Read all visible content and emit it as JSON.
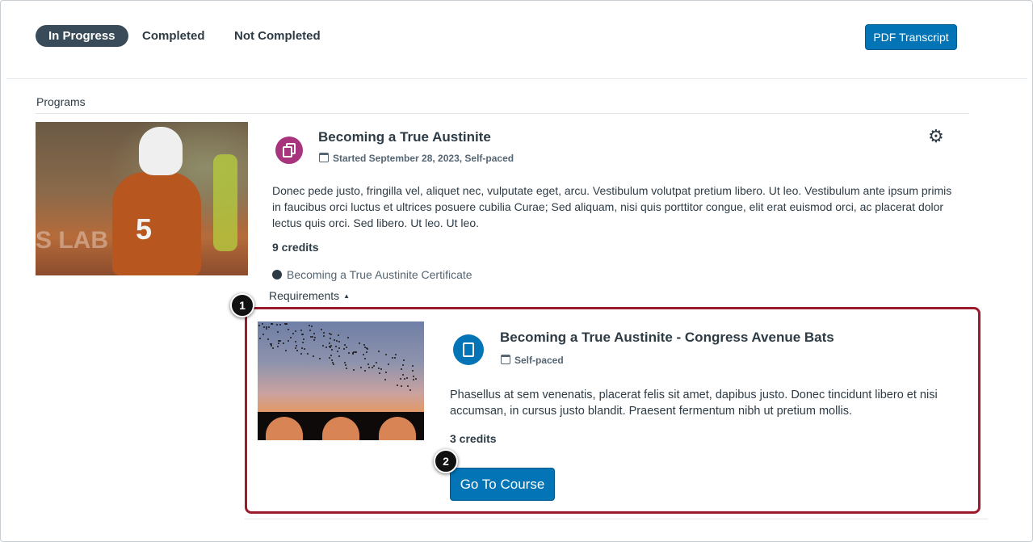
{
  "tabs": [
    {
      "label": "In Progress",
      "active": true
    },
    {
      "label": "Completed",
      "active": false
    },
    {
      "label": "Not Completed",
      "active": false
    }
  ],
  "header": {
    "pdf_button": "PDF Transcript"
  },
  "section_label": "Programs",
  "program": {
    "title": "Becoming a True Austinite",
    "meta": "Started September 28, 2023, Self-paced",
    "description": "Donec pede justo, fringilla vel, aliquet nec, vulputate eget, arcu. Vestibulum volutpat pretium libero. Ut leo. Vestibulum ante ipsum primis in faucibus orci luctus et ultrices posuere cubilia Curae; Sed aliquam, nisi quis porttitor congue, elit erat euismod orci, ac placerat dolor lectus quis orci. Sed libero. Ut leo. Ut leo.",
    "credits": "9 credits",
    "certificate": "Becoming a True Austinite Certificate",
    "requirements_label": "Requirements"
  },
  "requirement": {
    "title": "Becoming a True Austinite - Congress Avenue Bats",
    "meta": "Self-paced",
    "description": "Phasellus at sem venenatis, placerat felis sit amet, dapibus justo. Donec tincidunt libero et nisi accumsan, in cursus justo blandit. Praesent fermentum nibh ut pretium mollis.",
    "credits": "3 credits",
    "go_button": "Go To Course"
  },
  "callouts": [
    "1",
    "2"
  ],
  "hero_image": {
    "jersey_number": "5",
    "jersey_text": "TEXAS"
  },
  "colors": {
    "primary": "#0374b5",
    "program_icon": "#a9347e",
    "card_border": "#9b1b2c",
    "tab_active": "#394b58"
  },
  "icons": {
    "program": "program-icon",
    "course": "book-icon",
    "calendar": "calendar-icon",
    "settings": "gear-icon",
    "certificate": "certificate-icon"
  }
}
